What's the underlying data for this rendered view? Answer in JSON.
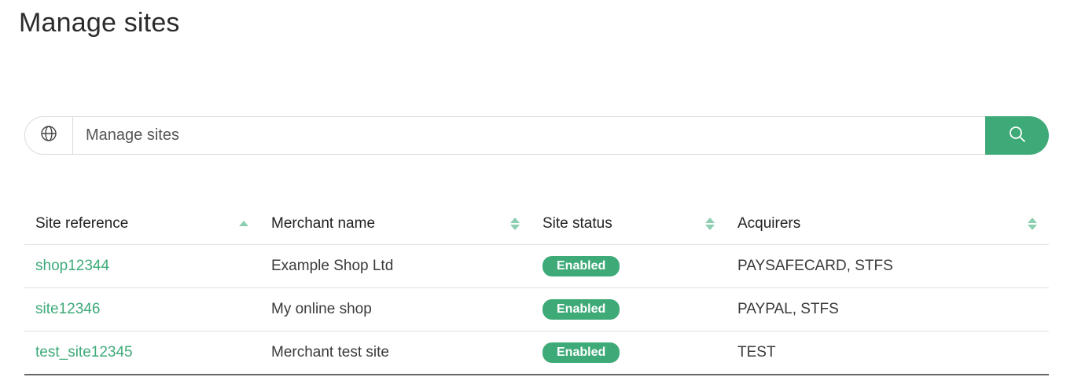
{
  "page": {
    "title": "Manage sites"
  },
  "search": {
    "placeholder": "Manage sites",
    "value": "",
    "prefix_icon": "globe-icon",
    "button_icon": "search-icon"
  },
  "colors": {
    "accent": "#3daa78",
    "sort_indicator": "#8ccfb0"
  },
  "table": {
    "columns": [
      {
        "label": "Site reference",
        "sort": "ascending"
      },
      {
        "label": "Merchant name",
        "sort": "none"
      },
      {
        "label": "Site status",
        "sort": "none"
      },
      {
        "label": "Acquirers",
        "sort": "none"
      }
    ],
    "rows": [
      {
        "site_reference": "shop12344",
        "merchant_name": "Example Shop Ltd",
        "status": "Enabled",
        "acquirers": "PAYSAFECARD, STFS"
      },
      {
        "site_reference": "site12346",
        "merchant_name": "My online shop",
        "status": "Enabled",
        "acquirers": "PAYPAL, STFS"
      },
      {
        "site_reference": "test_site12345",
        "merchant_name": "Merchant test site",
        "status": "Enabled",
        "acquirers": "TEST"
      }
    ]
  }
}
